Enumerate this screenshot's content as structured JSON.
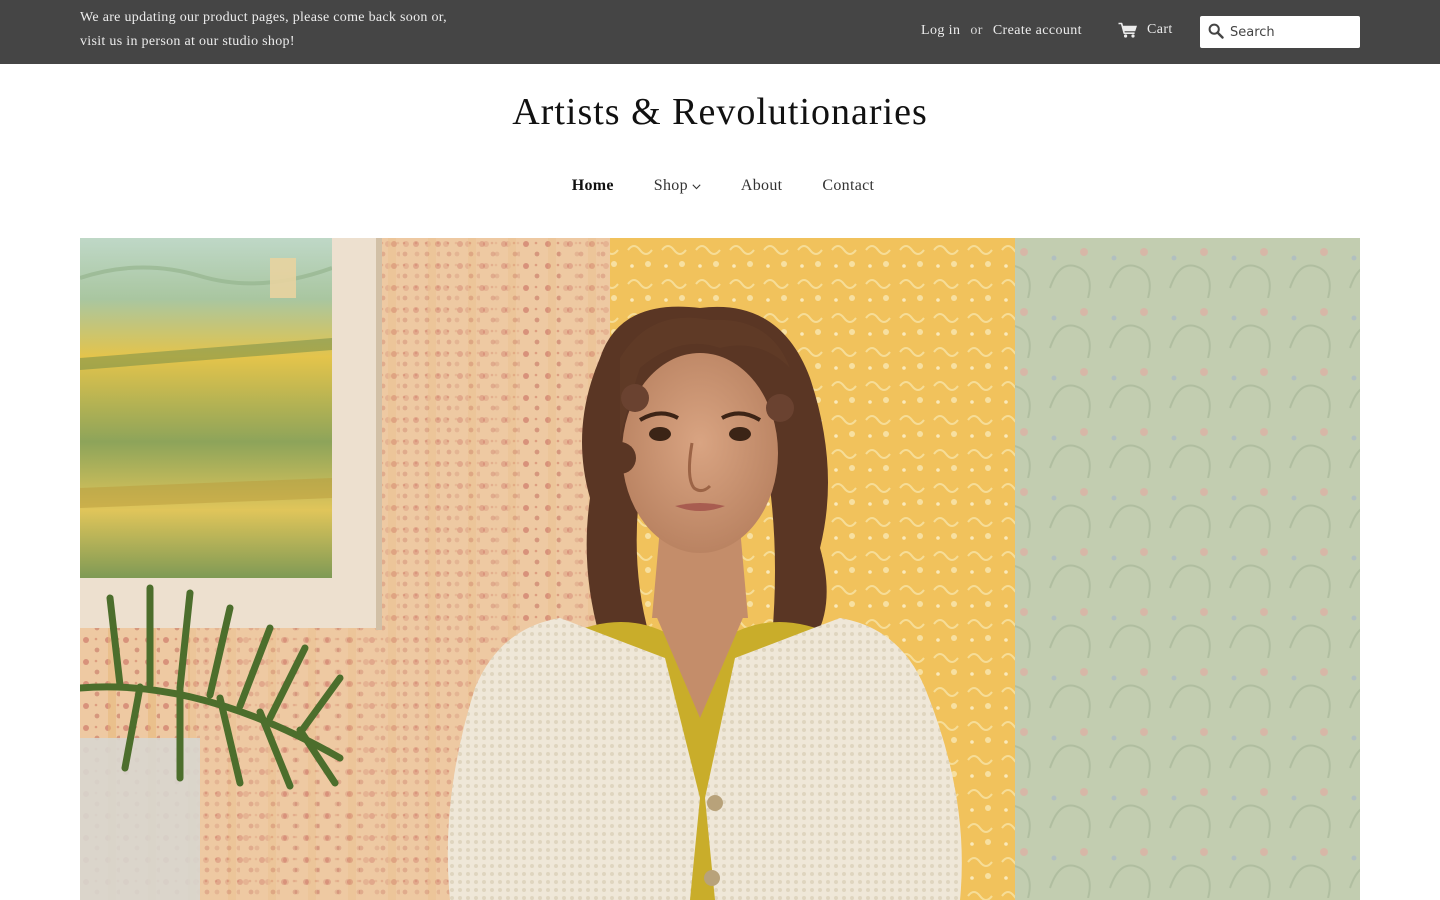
{
  "announcement": {
    "line1": "We are updating our product pages, please come back soon or,",
    "line2": "visit us in person at our studio shop!"
  },
  "account": {
    "login_label": "Log in",
    "or_label": "or",
    "create_label": "Create account"
  },
  "cart": {
    "label": "Cart",
    "icon": "cart-icon"
  },
  "search": {
    "placeholder": "Search",
    "value": "",
    "icon": "search-icon"
  },
  "site": {
    "title": "Artists & Revolutionaries"
  },
  "nav": {
    "home": "Home",
    "shop": "Shop",
    "about": "About",
    "contact": "Contact",
    "active": "Home"
  },
  "hero": {
    "alt": "Woman with curly hair in a cream knit cardigan and yellow top standing in front of patterned wallpaper, a framed landscape painting and a fern",
    "colors": {
      "wallpaper_red": "#ecc49b",
      "wallpaper_yellow": "#f1c25c",
      "wallpaper_green": "#b9c6a5",
      "cardigan": "#efe6d6",
      "top": "#c9ad2a"
    }
  },
  "colors": {
    "topbar_bg": "#454545",
    "topbar_text": "#ececec",
    "page_bg": "#ffffff",
    "title_text": "#111111"
  }
}
